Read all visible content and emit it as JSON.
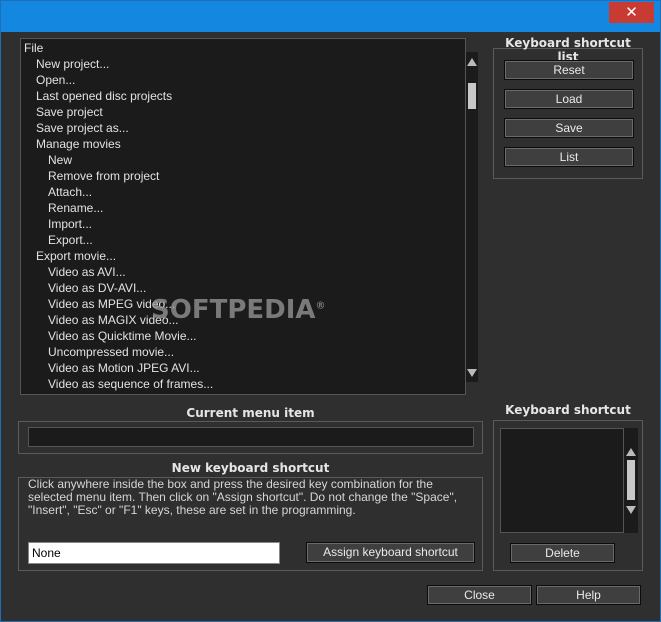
{
  "titlebar": {
    "close_glyph": "✕"
  },
  "tree": {
    "items": [
      {
        "label": "File",
        "indent": 0
      },
      {
        "label": "New project...",
        "indent": 1
      },
      {
        "label": "Open...",
        "indent": 1
      },
      {
        "label": "Last opened disc projects",
        "indent": 1
      },
      {
        "label": "Save project",
        "indent": 1
      },
      {
        "label": "Save project as...",
        "indent": 1
      },
      {
        "label": "Manage movies",
        "indent": 1
      },
      {
        "label": "New",
        "indent": 2
      },
      {
        "label": "Remove from project",
        "indent": 2
      },
      {
        "label": "Attach...",
        "indent": 2
      },
      {
        "label": "Rename...",
        "indent": 2
      },
      {
        "label": "Import...",
        "indent": 2
      },
      {
        "label": "Export...",
        "indent": 2
      },
      {
        "label": "Export movie...",
        "indent": 1
      },
      {
        "label": "Video as AVI...",
        "indent": 2
      },
      {
        "label": "Video as DV-AVI...",
        "indent": 2
      },
      {
        "label": "Video as MPEG video...",
        "indent": 2
      },
      {
        "label": "Video as MAGIX video...",
        "indent": 2
      },
      {
        "label": "Video as Quicktime Movie...",
        "indent": 2
      },
      {
        "label": "Uncompressed movie...",
        "indent": 2
      },
      {
        "label": "Video as Motion JPEG AVI...",
        "indent": 2
      },
      {
        "label": "Video as sequence of frames...",
        "indent": 2
      }
    ],
    "scroll_position": 0.05
  },
  "watermark": {
    "text": "SOFTPEDIA",
    "mark": "®"
  },
  "shortcut_list": {
    "title": "Keyboard shortcut list",
    "reset": "Reset",
    "load": "Load",
    "save": "Save",
    "list": "List"
  },
  "current_item": {
    "title": "Current menu item",
    "value": ""
  },
  "new_shortcut": {
    "title": "New keyboard shortcut",
    "description": "Click anywhere inside the box and press the desired key combination for the selected menu item. Then click on \"Assign shortcut\". Do not change the \"Space\", \"Insert\", \"Esc\" or \"F1\" keys, these are set in the programming.",
    "input_value": "None",
    "assign": "Assign keyboard shortcut"
  },
  "keyboard_shortcut": {
    "title": "Keyboard shortcut",
    "delete": "Delete"
  },
  "footer": {
    "close": "Close",
    "help": "Help"
  },
  "colors": {
    "window_bg": "#2f2f2f",
    "titlebar": "#1488e0",
    "close_button": "#c83b33",
    "list_bg": "#1b1b1b"
  }
}
